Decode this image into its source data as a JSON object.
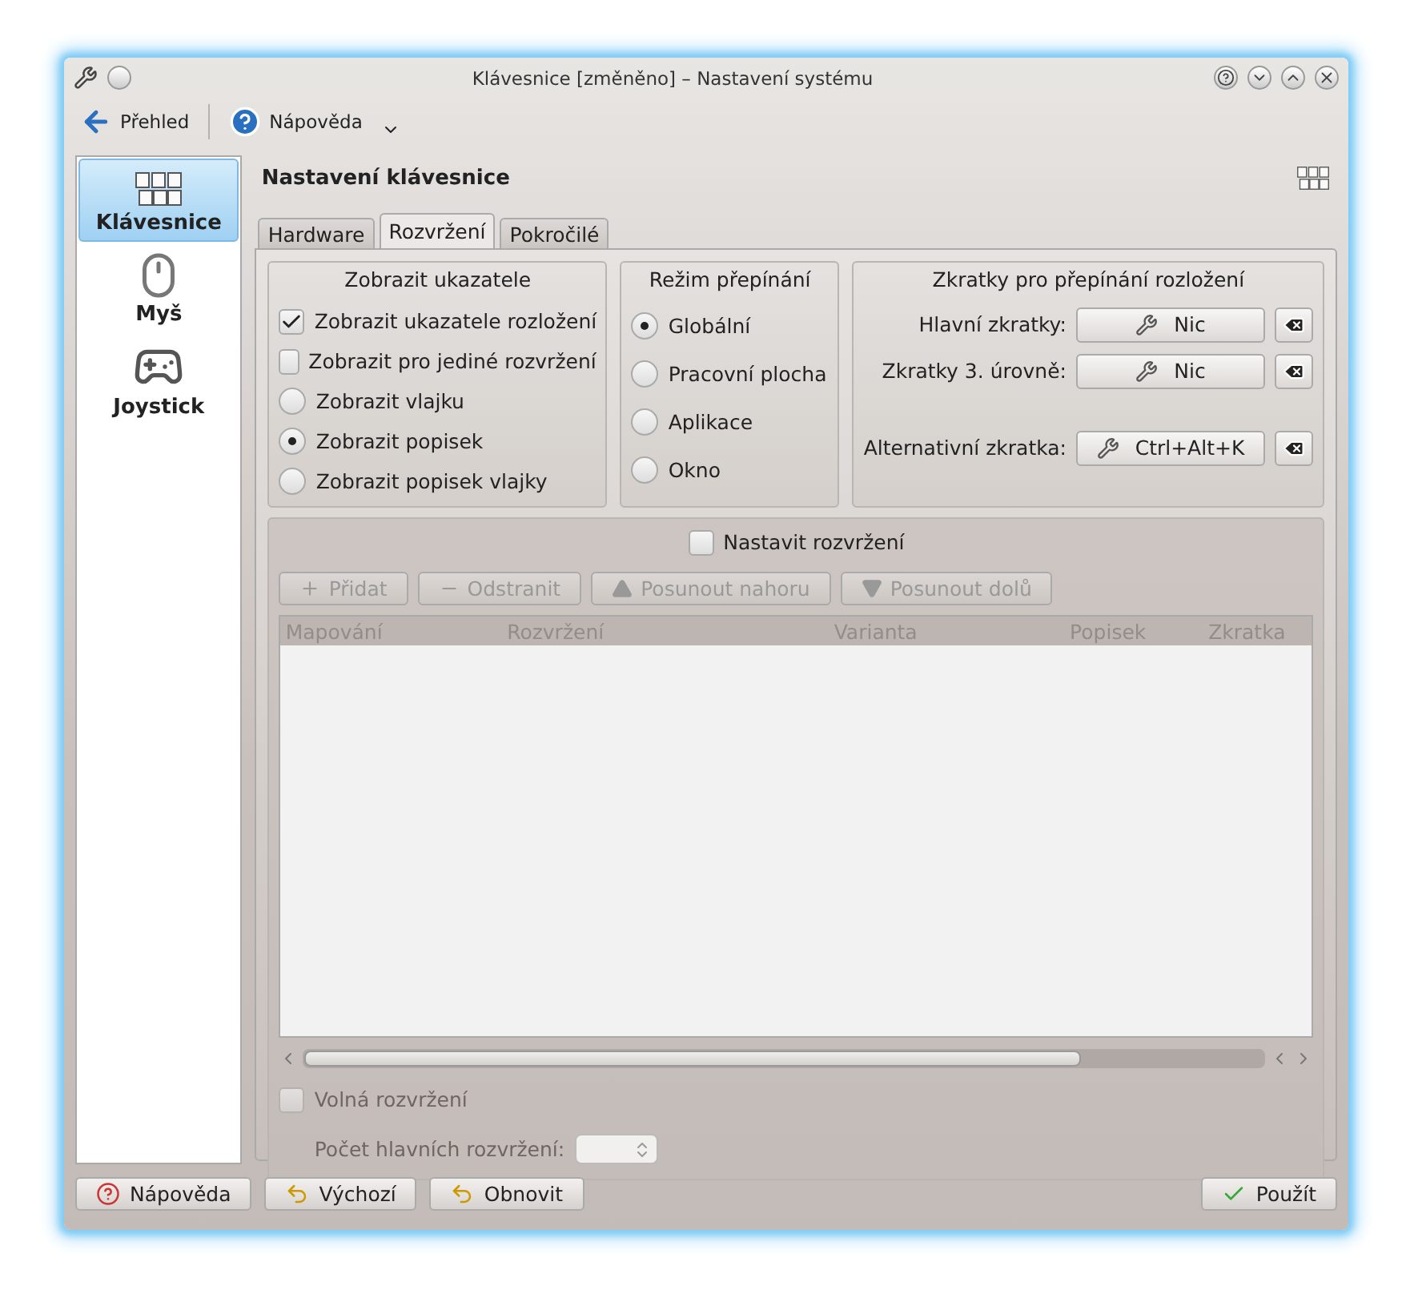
{
  "window": {
    "title": "Klávesnice [změněno] – Nastavení systému"
  },
  "toolbar": [
    {
      "label": "Přehled",
      "kind": "back"
    },
    {
      "label": "Nápověda",
      "kind": "help"
    }
  ],
  "sidebar": {
    "items": [
      {
        "label": "Klávesnice",
        "kind": "keyboard",
        "selected": true
      },
      {
        "label": "Myš",
        "kind": "mouse",
        "selected": false
      },
      {
        "label": "Joystick",
        "kind": "joystick",
        "selected": false
      }
    ]
  },
  "header": {
    "title": "Nastavení klávesnice"
  },
  "tabs": [
    {
      "label": "Hardware",
      "selected": false
    },
    {
      "label": "Rozvržení",
      "selected": true
    },
    {
      "label": "Pokročilé",
      "selected": false
    }
  ],
  "indicators": {
    "title": "Zobrazit ukazatele",
    "options": [
      {
        "label": "Zobrazit ukazatele rozložení",
        "kind": "checkbox",
        "checked": true
      },
      {
        "label": "Zobrazit pro jediné rozvržení",
        "kind": "checkbox",
        "checked": false
      },
      {
        "label": "Zobrazit vlajku",
        "kind": "radio",
        "checked": false
      },
      {
        "label": "Zobrazit popisek",
        "kind": "radio",
        "checked": true
      },
      {
        "label": "Zobrazit popisek vlajky",
        "kind": "radio",
        "checked": false
      }
    ]
  },
  "switching_mode": {
    "title": "Režim přepínání",
    "options": [
      {
        "label": "Globální",
        "selected": true
      },
      {
        "label": "Pracovní plocha",
        "selected": false
      },
      {
        "label": "Aplikace",
        "selected": false
      },
      {
        "label": "Okno",
        "selected": false
      }
    ]
  },
  "shortcuts": {
    "title": "Zkratky pro přepínání rozložení",
    "rows": [
      {
        "label": "Hlavní zkratky:",
        "value": "Nic"
      },
      {
        "label": "Zkratky 3. úrovně:",
        "value": "Nic"
      },
      {
        "label": "Alternativní zkratka:",
        "value": "Ctrl+Alt+K"
      }
    ]
  },
  "layouts": {
    "label": "Nastavit rozvržení",
    "checked": false,
    "buttons": [
      {
        "label": "Přidat",
        "kind": "add",
        "disabled": true
      },
      {
        "label": "Odstranit",
        "kind": "remove",
        "disabled": true
      },
      {
        "label": "Posunout nahoru",
        "kind": "up",
        "disabled": true
      },
      {
        "label": "Posunout dolů",
        "kind": "down",
        "disabled": true
      }
    ],
    "columns": [
      "Mapování",
      "Rozvržení",
      "Varianta",
      "Popisek",
      "Zkratka"
    ],
    "free_layouts": {
      "label": "Volná rozvržení",
      "checked": false,
      "disabled": true
    },
    "main_count": {
      "label": "Počet hlavních rozvržení:",
      "disabled": true
    }
  },
  "footer": [
    {
      "label": "Nápověda",
      "kind": "help"
    },
    {
      "label": "Výchozí",
      "kind": "defaults"
    },
    {
      "label": "Obnovit",
      "kind": "reset"
    },
    {
      "label": "Použít",
      "kind": "apply"
    }
  ]
}
